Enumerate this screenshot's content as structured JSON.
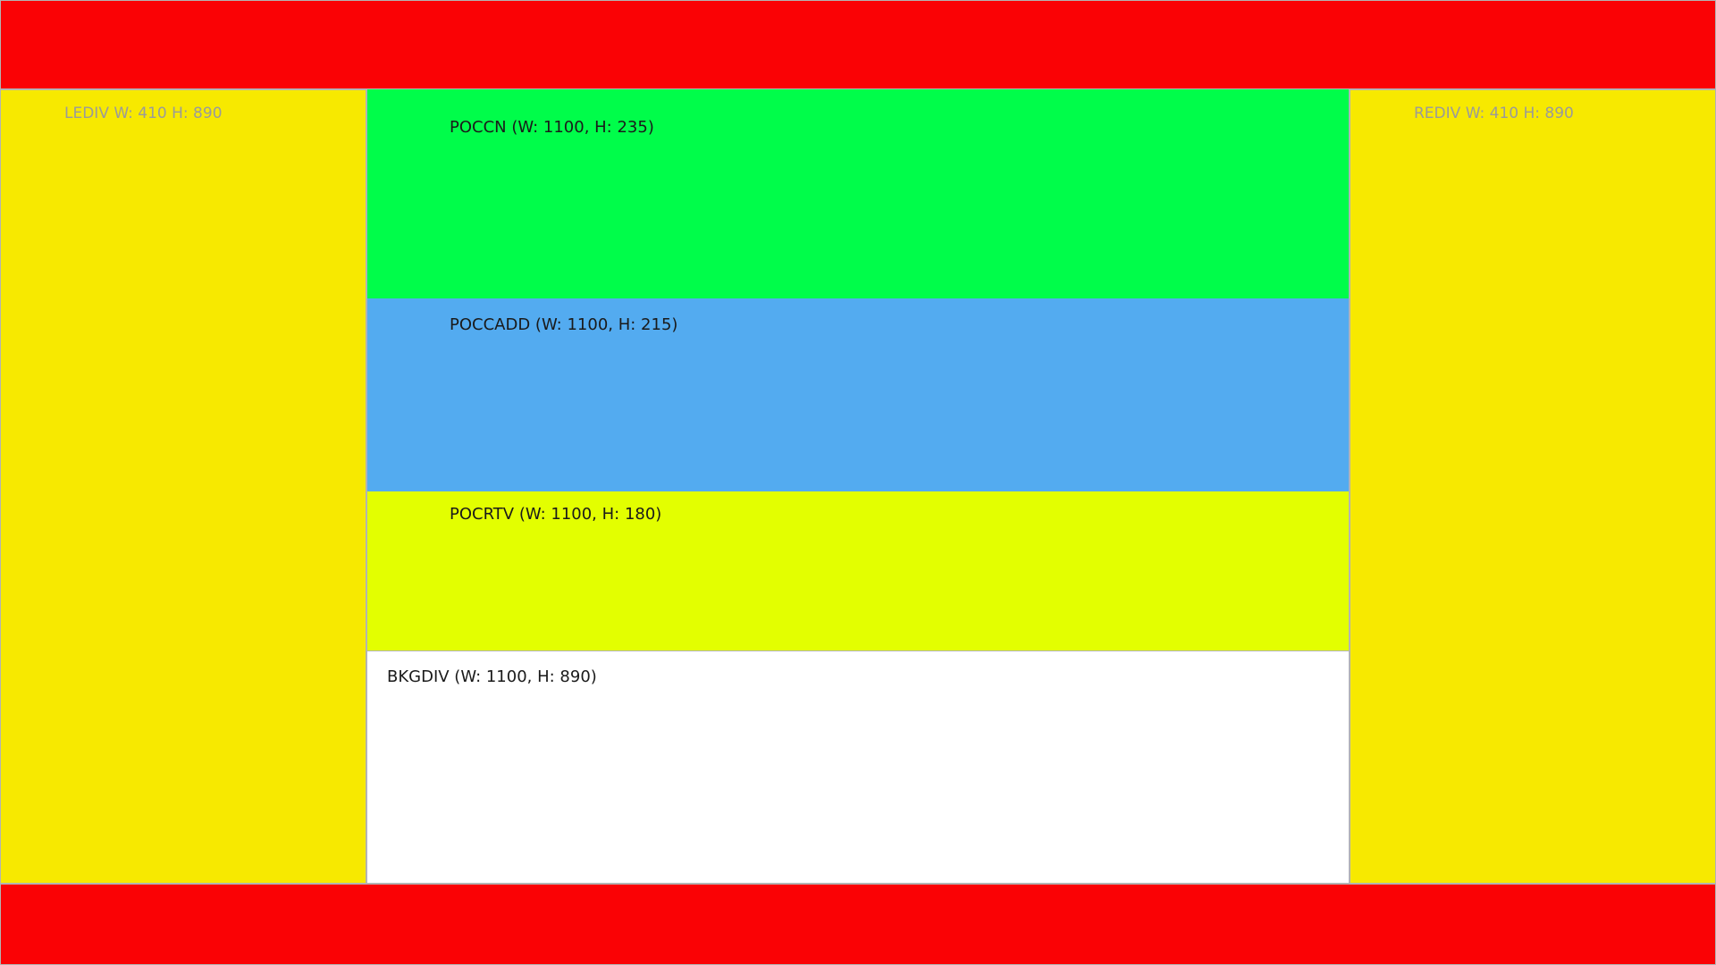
{
  "colors": {
    "band": "#fa0205",
    "side": "#f7e900",
    "poccn": "#00fd4a",
    "poccadd": "#53abf0",
    "pocrtv": "#e3ff00",
    "bkgdiv": "#ffffff"
  },
  "left_div": {
    "label": "LEDIV W: 410 H: 890"
  },
  "right_div": {
    "label": "REDIV W: 410 H: 890"
  },
  "center": {
    "poccn": {
      "label": "POCCN (W: 1100, H: 235)"
    },
    "poccadd": {
      "label": "POCCADD (W: 1100, H: 215)"
    },
    "pocrtv": {
      "label": "POCRTV (W: 1100, H: 180)"
    },
    "bkgdiv": {
      "label": "BKGDIV (W: 1100, H: 890)"
    }
  }
}
